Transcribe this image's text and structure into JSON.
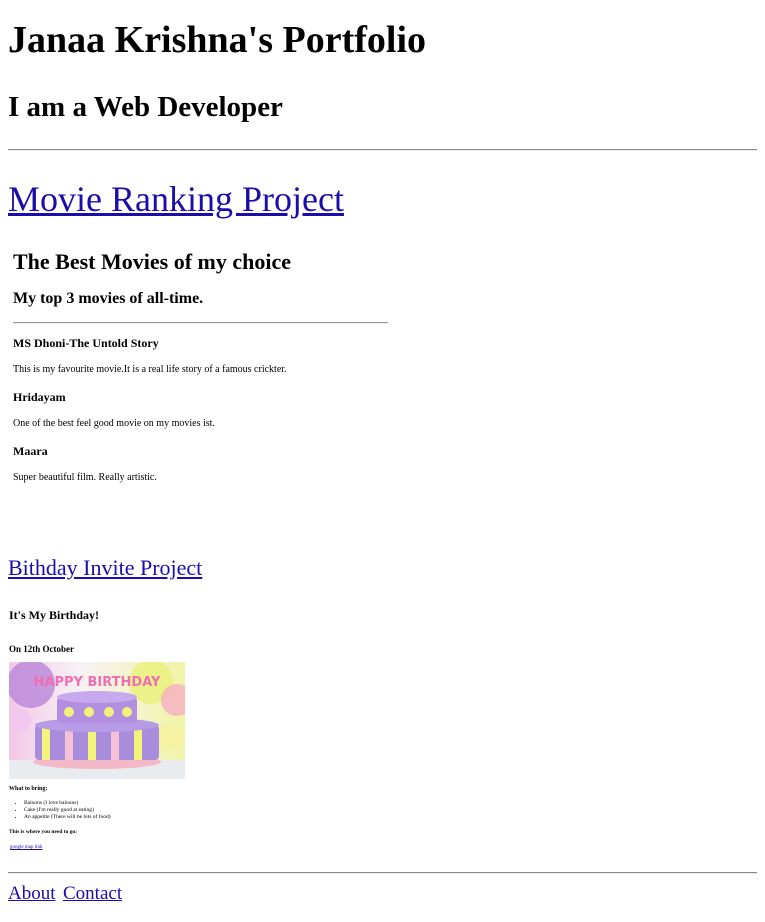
{
  "header": {
    "title": "Janaa Krishna's Portfolio",
    "subtitle": "I am a Web Developer"
  },
  "projects": {
    "movie": {
      "link_label": "Movie Ranking Project",
      "heading": "The Best Movies of my choice",
      "subheading": "My top 3 movies of all-time.",
      "movies": [
        {
          "title": "MS Dhoni-The Untold Story",
          "description": "This is my favourite movie.It is a real life story of a famous crickter."
        },
        {
          "title": "Hridayam",
          "description": "One of the best feel good movie on my movies ist."
        },
        {
          "title": "Maara",
          "description": "Super beautiful film. Really artistic."
        }
      ]
    },
    "birthday": {
      "link_label": "Bithday Invite Project",
      "title": "It's My Birthday!",
      "date": "On 12th October",
      "cake_text": "HAPPY BIRTHDAY",
      "bring_heading": "What to bring:",
      "bring_items": [
        "Baloons (I love baloons)",
        "Cake (I'm really good at eating)",
        "An appetite (There will be lots of food)"
      ],
      "where_heading": "This is where you need to go:",
      "map_link": "google map link"
    }
  },
  "footer": {
    "about": "About",
    "contact": "Contact"
  },
  "colors": {
    "link": "#1a0dab",
    "text": "#000000"
  }
}
